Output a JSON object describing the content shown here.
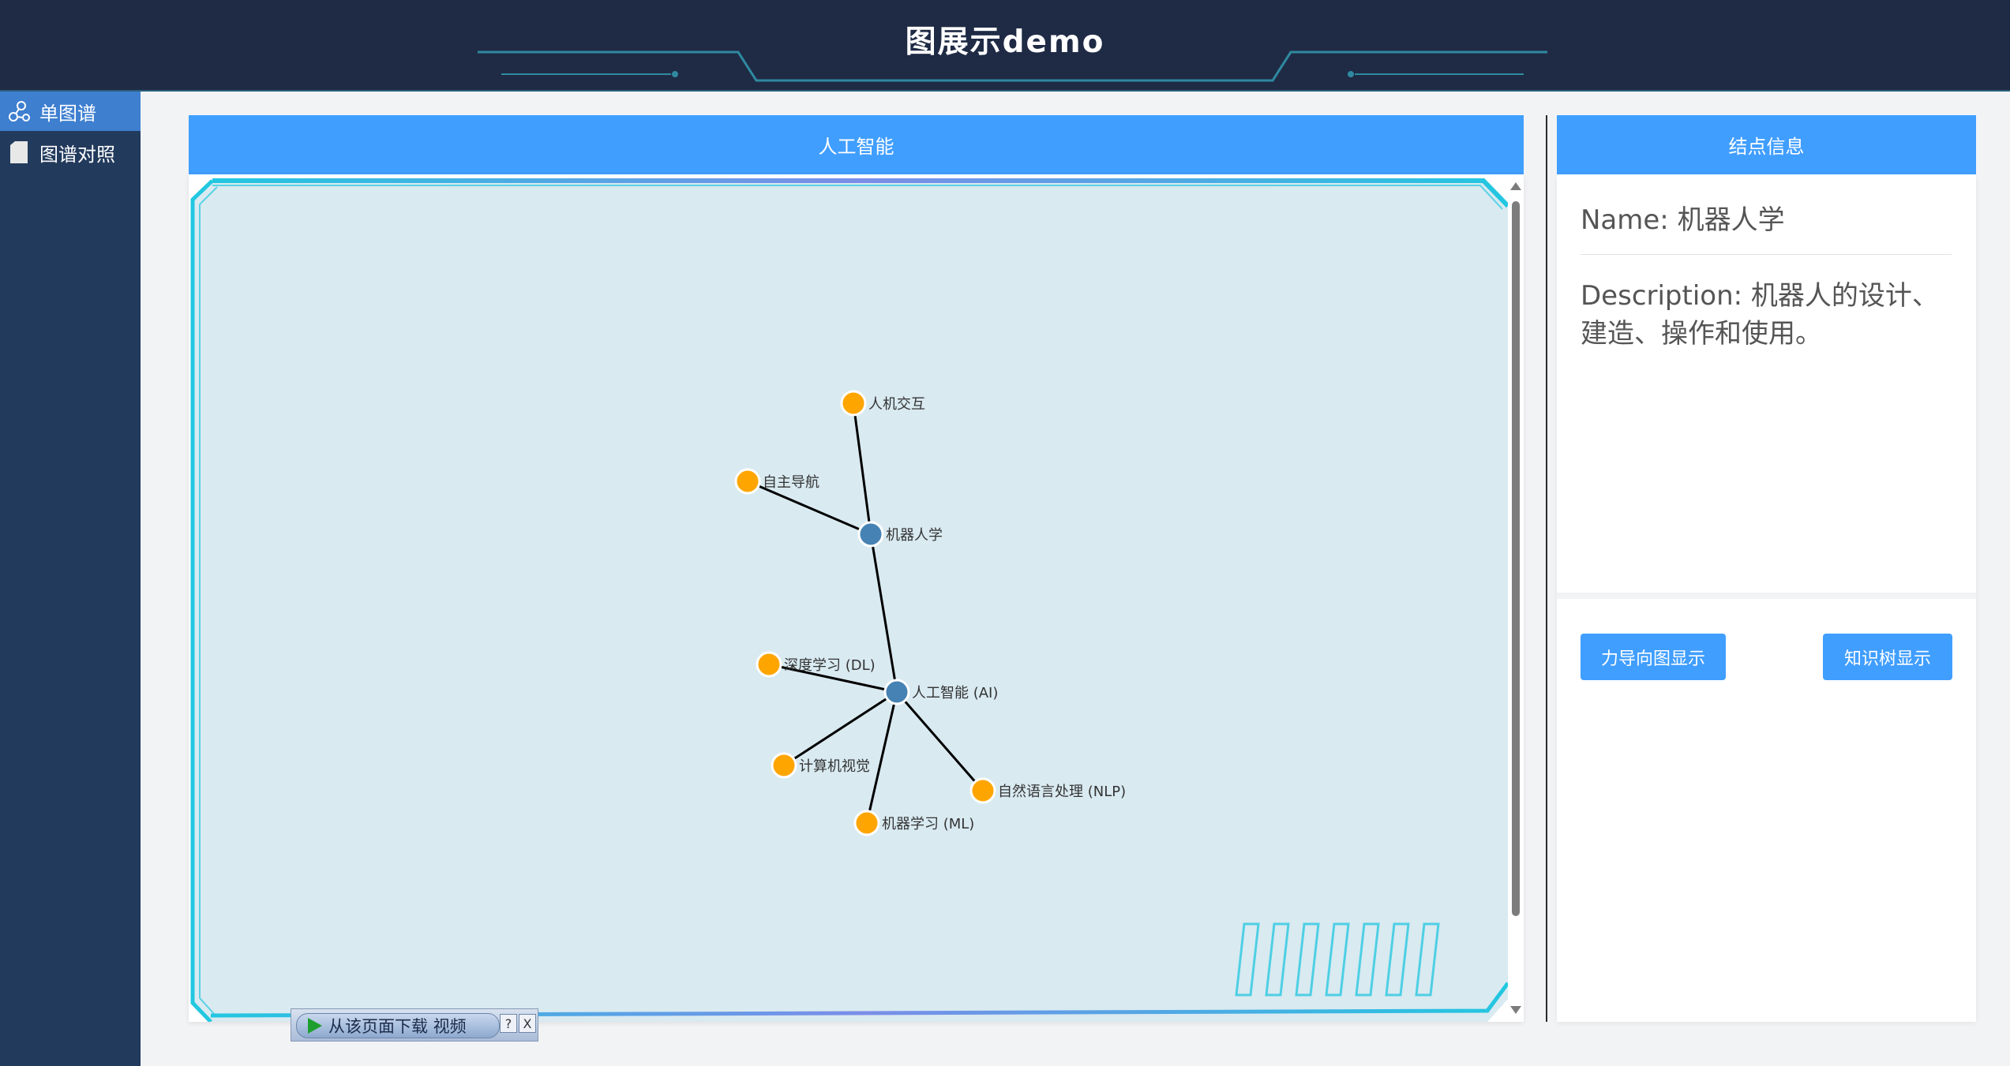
{
  "app": {
    "title": "图展示demo"
  },
  "sidebar": {
    "items": [
      {
        "label": "单图谱",
        "icon": "graph-icon",
        "active": true
      },
      {
        "label": "图谱对照",
        "icon": "document-icon",
        "active": false
      }
    ]
  },
  "graph_panel": {
    "title": "人工智能",
    "nodes": [
      {
        "id": "ai",
        "label": "人工智能 (AI)",
        "type": "center",
        "color": "#4682b4"
      },
      {
        "id": "robotics",
        "label": "机器人学",
        "type": "center",
        "color": "#4682b4"
      },
      {
        "id": "hci",
        "label": "人机交互",
        "type": "leaf",
        "color": "#ffa500"
      },
      {
        "id": "nav",
        "label": "自主导航",
        "type": "leaf",
        "color": "#ffa500"
      },
      {
        "id": "dl",
        "label": "深度学习 (DL)",
        "type": "leaf",
        "color": "#ffa500"
      },
      {
        "id": "cv",
        "label": "计算机视觉",
        "type": "leaf",
        "color": "#ffa500"
      },
      {
        "id": "ml",
        "label": "机器学习 (ML)",
        "type": "leaf",
        "color": "#ffa500"
      },
      {
        "id": "nlp",
        "label": "自然语言处理 (NLP)",
        "type": "leaf",
        "color": "#ffa500"
      }
    ],
    "edges": [
      [
        "robotics",
        "hci"
      ],
      [
        "robotics",
        "nav"
      ],
      [
        "ai",
        "robotics"
      ],
      [
        "ai",
        "dl"
      ],
      [
        "ai",
        "cv"
      ],
      [
        "ai",
        "ml"
      ],
      [
        "ai",
        "nlp"
      ]
    ]
  },
  "info_panel": {
    "title": "结点信息",
    "name_line": "Name: 机器人学",
    "description_line": "Description: 机器人的设计、建造、操作和使用。",
    "force_button": "力导向图显示",
    "tree_button": "知识树显示"
  },
  "download_bar": {
    "label": "从该页面下载 视频",
    "help": "?",
    "close": "X"
  },
  "colors": {
    "accent": "#409eff",
    "header_bg": "#1f2b45",
    "sidebar_bg": "#223a5c",
    "graph_bg": "#d9eaf1"
  }
}
